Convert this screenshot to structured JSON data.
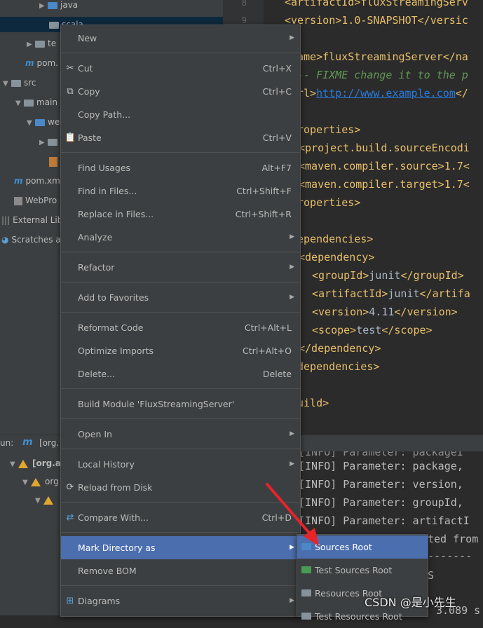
{
  "project_tree": {
    "items": [
      "java",
      "scala",
      "te",
      "pom.",
      "src",
      "main",
      "we",
      "pom.xm",
      "WebPro",
      "External Lib",
      "Scratches a"
    ]
  },
  "gutter": {
    "line_numbers": [
      "8",
      "9"
    ]
  },
  "editor": {
    "lines": {
      "l1": "<artifactId>fluxStreamingServ",
      "l2": "<version>1.0-SNAPSHOT</versic",
      "l3": "ame>fluxStreamingServer</na",
      "l4a": "-- ",
      "l4b": "FIXME change it to the p",
      "l5a": "rl>",
      "l5b": "http://www.example.com",
      "l5c": "</",
      "l6": "roperties>",
      "l7": "<project.build.sourceEncodi",
      "l8": "<maven.compiler.source>1.7<",
      "l9": "<maven.compiler.target>1.7<",
      "l10": "roperties>",
      "l11": "ependencies>",
      "l12": "<dependency>",
      "l13a": "<groupId>",
      "l13b": "junit",
      "l13c": "</groupId>",
      "l14a": "<artifactId>",
      "l14b": "junit",
      "l14c": "</artifa",
      "l15a": "<version>",
      "l15b": "4.11",
      "l15c": "</version>",
      "l16a": "<scope>",
      "l16b": "test",
      "l16c": "</scope>",
      "l17": "</dependency>",
      "l18": "dependencies>",
      "l19": "uild>"
    }
  },
  "run_panel": {
    "label": "un:",
    "tab": "[org.",
    "tree": [
      "[org.a",
      "org",
      ""
    ],
    "console": [
      "[INFO] Parameter: packageI",
      "[INFO] Parameter: package,",
      "[INFO] Parameter: version,",
      "[INFO] Parameter: groupId,",
      "[INFO] Parameter: artifactI",
      "ted from",
      "-------",
      "S",
      "3.089 s"
    ]
  },
  "context_menu": {
    "items": [
      {
        "label": "New",
        "shortcut": "",
        "submenu": true
      },
      {
        "label": "Cut",
        "shortcut": "Ctrl+X",
        "icon": "scissors"
      },
      {
        "label": "Copy",
        "shortcut": "Ctrl+C",
        "icon": "copy"
      },
      {
        "label": "Copy Path...",
        "shortcut": ""
      },
      {
        "label": "Paste",
        "shortcut": "Ctrl+V",
        "icon": "clipboard"
      },
      {
        "label": "Find Usages",
        "shortcut": "Alt+F7"
      },
      {
        "label": "Find in Files...",
        "shortcut": "Ctrl+Shift+F"
      },
      {
        "label": "Replace in Files...",
        "shortcut": "Ctrl+Shift+R"
      },
      {
        "label": "Analyze",
        "shortcut": "",
        "submenu": true
      },
      {
        "label": "Refactor",
        "shortcut": "",
        "submenu": true
      },
      {
        "label": "Add to Favorites",
        "shortcut": "",
        "submenu": true
      },
      {
        "label": "Reformat Code",
        "shortcut": "Ctrl+Alt+L"
      },
      {
        "label": "Optimize Imports",
        "shortcut": "Ctrl+Alt+O"
      },
      {
        "label": "Delete...",
        "shortcut": "Delete"
      },
      {
        "label": "Build Module 'FluxStreamingServer'",
        "shortcut": ""
      },
      {
        "label": "Open In",
        "shortcut": "",
        "submenu": true
      },
      {
        "label": "Local History",
        "shortcut": "",
        "submenu": true
      },
      {
        "label": "Reload from Disk",
        "shortcut": "",
        "icon": "reload"
      },
      {
        "label": "Compare With...",
        "shortcut": "Ctrl+D",
        "icon": "compare"
      },
      {
        "label": "Mark Directory as",
        "shortcut": "",
        "submenu": true,
        "highlighted": true
      },
      {
        "label": "Remove BOM",
        "shortcut": ""
      },
      {
        "label": "Diagrams",
        "shortcut": "",
        "submenu": true,
        "icon": "diagram"
      }
    ]
  },
  "submenu": {
    "items": [
      {
        "label": "Sources Root",
        "color": "#4a88c7",
        "highlighted": true
      },
      {
        "label": "Test Sources Root",
        "color": "#499c54"
      },
      {
        "label": "Resources Root",
        "color": "#87939a"
      },
      {
        "label": "Test Resources Root",
        "color": "#87939a"
      }
    ]
  },
  "watermark": "CSDN @是小先生",
  "colors": {
    "highlight": "#4b6eaf",
    "menu_bg": "#3c3f41",
    "annotation_arrow": "#e8232a"
  }
}
